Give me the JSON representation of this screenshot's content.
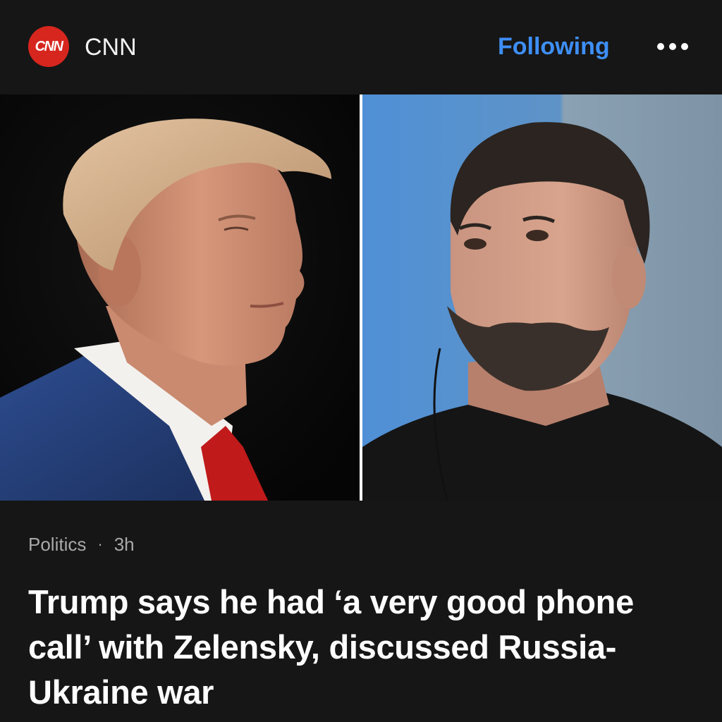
{
  "header": {
    "source_logo_text": "CNN",
    "source_name": "CNN",
    "follow_label": "Following",
    "more_icon": "more-horizontal-icon"
  },
  "hero": {
    "left_photo": "portrait of Donald Trump in profile",
    "right_photo": "portrait of Volodymyr Zelensky"
  },
  "article": {
    "category": "Politics",
    "separator": "·",
    "age": "3h",
    "headline": "Trump says he had ‘a very good phone call’ with Zelensky, discussed Russia-Ukraine war"
  },
  "colors": {
    "background": "#161616",
    "accent": "#3e8ef7",
    "logo_red": "#d7261e",
    "meta_text": "#a9a9a9",
    "headline_text": "#ffffff"
  }
}
